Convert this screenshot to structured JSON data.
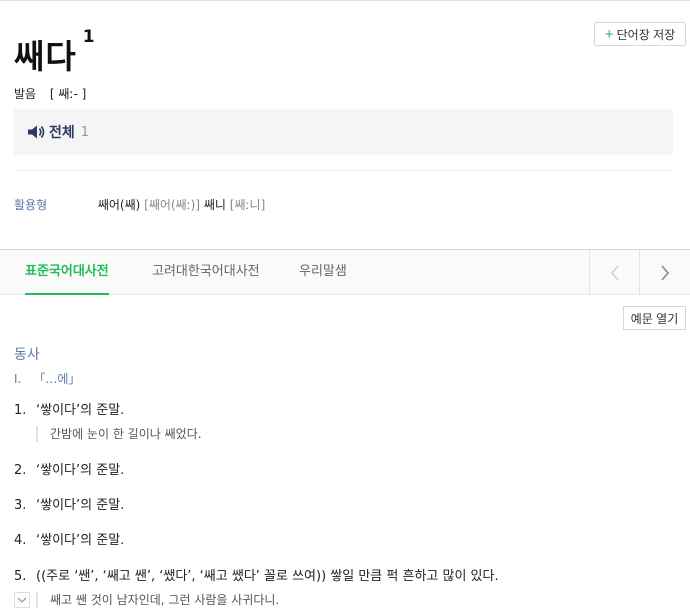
{
  "header": {
    "headword": "쌔다",
    "homonym_number": "1",
    "save_button_label": "단어장 저장"
  },
  "pronunciation": {
    "label": "발음",
    "value": "[ 쌔ː- ]"
  },
  "audio": {
    "label": "전체",
    "count": "1"
  },
  "conjugation": {
    "label": "활용형",
    "forms": [
      {
        "word": "쌔어(쌔)",
        "pron": "[쌔어(쌔ː)]"
      },
      {
        "word": "쌔니",
        "pron": "[쌔ː니]"
      }
    ]
  },
  "tabs": [
    {
      "label": "표준국어대사전",
      "active": true
    },
    {
      "label": "고려대한국어대사전",
      "active": false
    },
    {
      "label": "우리말샘",
      "active": false
    }
  ],
  "example_toggle_label": "예문 열기",
  "entry": {
    "part_of_speech": "동사",
    "sense_group": {
      "roman": "I.",
      "pattern": "「…에」"
    },
    "senses": [
      {
        "num": "1.",
        "text": "‘쌓이다’의 준말.",
        "example": "간밤에 눈이 한 길이나 쌔었다."
      },
      {
        "num": "2.",
        "text": "‘쌓이다’의 준말."
      },
      {
        "num": "3.",
        "text": "‘쌓이다’의 준말."
      },
      {
        "num": "4.",
        "text": "‘쌓이다’의 준말."
      },
      {
        "num": "5.",
        "text": "((주로 ‘쌘’, ‘쌔고 쌘’, ‘쌨다’, ‘쌔고 쌨다’ 꼴로 쓰여)) 쌓일 만큼 퍽 흔하고 많이 있다.",
        "example": "쌔고 쌘 것이 남자인데, 그런 사람을 사귀다니."
      }
    ]
  },
  "colors": {
    "accent_green": "#1fbe5a",
    "label_blue": "#5c7aa8",
    "audio_navy": "#2d3a5e"
  }
}
